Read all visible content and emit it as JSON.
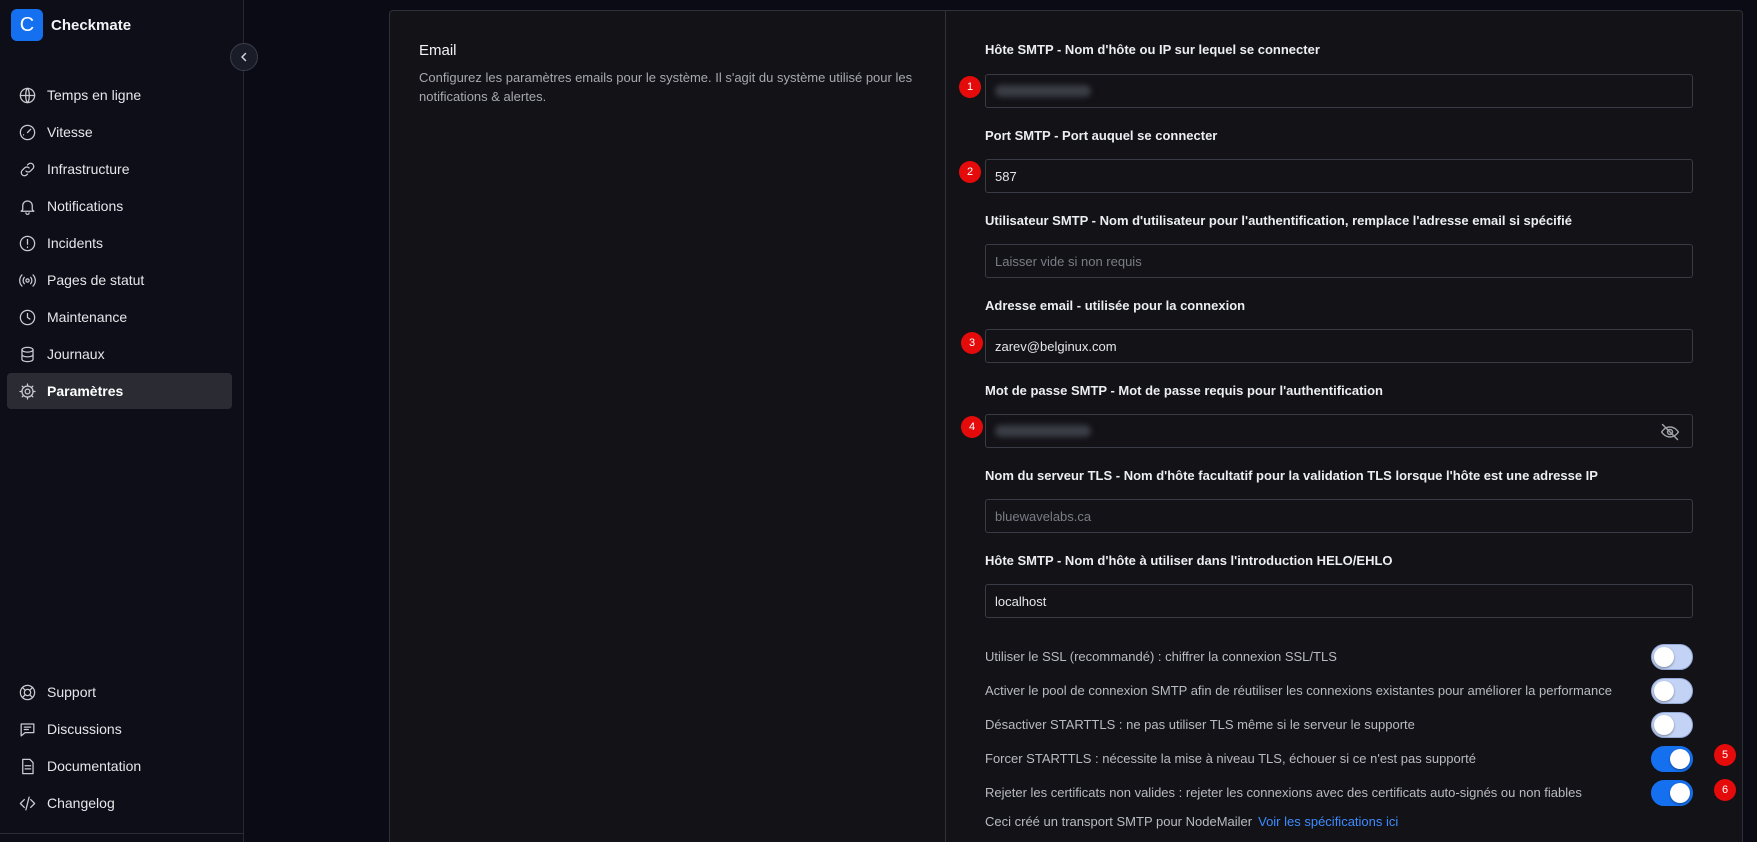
{
  "app": {
    "name": "Checkmate",
    "logo_letter": "C"
  },
  "sidebar": {
    "items": [
      {
        "label": "Temps en ligne",
        "icon": "globe-icon"
      },
      {
        "label": "Vitesse",
        "icon": "speedometer-icon"
      },
      {
        "label": "Infrastructure",
        "icon": "link-icon"
      },
      {
        "label": "Notifications",
        "icon": "bell-icon"
      },
      {
        "label": "Incidents",
        "icon": "alert-circle-icon"
      },
      {
        "label": "Pages de statut",
        "icon": "broadcast-icon"
      },
      {
        "label": "Maintenance",
        "icon": "clock-icon"
      },
      {
        "label": "Journaux",
        "icon": "database-icon"
      },
      {
        "label": "Paramètres",
        "icon": "gear-icon",
        "active": true
      }
    ],
    "bottom_items": [
      {
        "label": "Support",
        "icon": "lifebuoy-icon"
      },
      {
        "label": "Discussions",
        "icon": "chat-icon"
      },
      {
        "label": "Documentation",
        "icon": "document-icon"
      },
      {
        "label": "Changelog",
        "icon": "code-icon"
      }
    ]
  },
  "section": {
    "title": "Email",
    "description": "Configurez les paramètres emails pour le système. Il s'agit du système utilisé pour les notifications & alertes."
  },
  "fields": {
    "smtp_host": {
      "label": "Hôte SMTP - Nom d'hôte ou IP sur lequel se connecter",
      "value": "",
      "blurred": true
    },
    "smtp_port": {
      "label": "Port SMTP - Port auquel se connecter",
      "value": "587"
    },
    "smtp_user": {
      "label": "Utilisateur SMTP - Nom d'utilisateur pour l'authentification, remplace l'adresse email si spécifié",
      "placeholder": "Laisser vide si non requis"
    },
    "email": {
      "label": "Adresse email - utilisée pour la connexion",
      "value": "zarev@belginux.com"
    },
    "password": {
      "label": "Mot de passe SMTP - Mot de passe requis pour l'authentification",
      "value": "",
      "blurred": true
    },
    "tls_server": {
      "label": "Nom du serveur TLS - Nom d'hôte facultatif pour la validation TLS lorsque l'hôte est une adresse IP",
      "placeholder": "bluewavelabs.ca"
    },
    "helo_host": {
      "label": "Hôte SMTP - Nom d'hôte à utiliser dans l'introduction HELO/EHLO",
      "value": "localhost"
    }
  },
  "toggles": [
    {
      "label": "Utiliser le SSL (recommandé) : chiffrer la connexion SSL/TLS",
      "on": false
    },
    {
      "label": "Activer le pool de connexion SMTP afin de réutiliser les connexions existantes pour améliorer la performance",
      "on": false
    },
    {
      "label": "Désactiver STARTTLS : ne pas utiliser TLS même si le serveur le supporte",
      "on": false
    },
    {
      "label": "Forcer STARTTLS : nécessite la mise à niveau TLS, échouer si ce n'est pas supporté",
      "on": true
    },
    {
      "label": "Rejeter les certificats non valides : rejeter les connexions avec des certificats auto-signés ou non fiables",
      "on": true
    }
  ],
  "footer": {
    "text": "Ceci créé un transport SMTP pour NodeMailer",
    "link": "Voir les spécifications ici"
  },
  "annotations": [
    "1",
    "2",
    "3",
    "4",
    "5",
    "6"
  ],
  "colors": {
    "accent": "#1570ef",
    "badge": "#e50b0b",
    "background": "#0b0b16",
    "panel": "#121217"
  }
}
